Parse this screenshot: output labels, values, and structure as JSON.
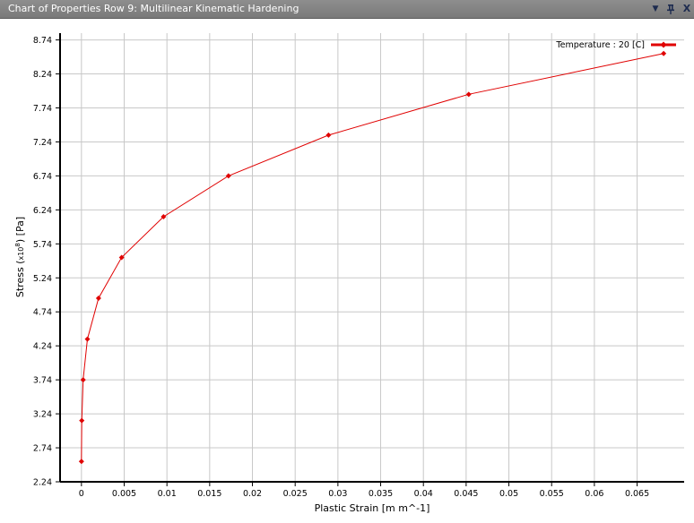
{
  "window": {
    "title": "Chart of Properties Row 9: Multilinear Kinematic Hardening",
    "controls": {
      "menu_icon": "dropdown-arrow-icon",
      "pin_icon": "pin-icon",
      "close_icon": "close-icon",
      "menu_glyph": "▼",
      "pin_glyph": "ᵽ",
      "close_glyph": "X"
    }
  },
  "colors": {
    "series": "#e00000",
    "grid": "#c8c8c8",
    "titlebar": "#858585"
  },
  "chart_data": {
    "type": "line",
    "xlabel": "Plastic Strain  [m m^-1]",
    "ylabel_main": "Stress  (",
    "ylabel_mult": "x10",
    "ylabel_exp": "8",
    "ylabel_unit": ")  [Pa]",
    "xlim": [
      -0.0025,
      0.0705
    ],
    "ylim": [
      2.24,
      8.84
    ],
    "x_ticks": [
      0,
      0.005,
      0.01,
      0.015,
      0.02,
      0.025,
      0.03,
      0.035,
      0.04,
      0.045,
      0.05,
      0.055,
      0.06,
      0.065
    ],
    "x_tick_labels": [
      "0",
      "0.005",
      "0.01",
      "0.015",
      "0.02",
      "0.025",
      "0.03",
      "0.035",
      "0.04",
      "0.045",
      "0.05",
      "0.055",
      "0.06",
      "0.065"
    ],
    "y_ticks": [
      2.24,
      2.74,
      3.24,
      3.74,
      4.24,
      4.74,
      5.24,
      5.74,
      6.24,
      6.74,
      7.24,
      7.74,
      8.24,
      8.74
    ],
    "y_tick_labels": [
      "2.24",
      "2.74",
      "3.24",
      "3.74",
      "4.24",
      "4.74",
      "5.24",
      "5.74",
      "6.24",
      "6.74",
      "7.24",
      "7.74",
      "8.24",
      "8.74"
    ],
    "grid": true,
    "legend_position": "top-right",
    "series": [
      {
        "name": "Temperature : 20 [C]",
        "color": "#e00000",
        "marker": "diamond",
        "x": [
          0,
          4e-05,
          0.0002,
          0.0007,
          0.002,
          0.0047,
          0.0096,
          0.0172,
          0.0289,
          0.0453,
          0.0681
        ],
        "y": [
          2.54,
          3.14,
          3.74,
          4.34,
          4.94,
          5.54,
          6.14,
          6.74,
          7.34,
          7.94,
          8.54
        ]
      }
    ]
  }
}
